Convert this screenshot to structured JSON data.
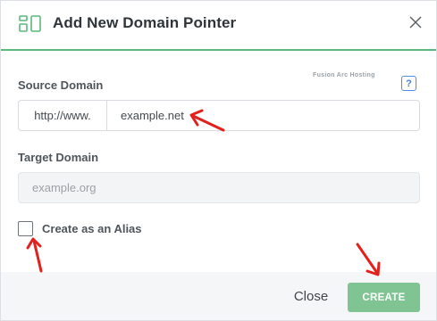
{
  "dialog": {
    "title": "Add New Domain Pointer",
    "header_icon": "domain-pointer-icon",
    "close_icon": "close-icon"
  },
  "source": {
    "label": "Source Domain",
    "prefix": "http://www.",
    "value": "example.net",
    "help_label": "?"
  },
  "watermark": "Fusion Arc Hosting",
  "target": {
    "label": "Target Domain",
    "placeholder": "example.org"
  },
  "alias": {
    "label": "Create as an Alias",
    "checked": false
  },
  "footer": {
    "close_label": "Close",
    "create_label": "CREATE"
  },
  "colors": {
    "accent": "#59b87c",
    "create_button": "#7fc492",
    "annotation_arrow": "#e3211c",
    "help": "#3b82e0"
  }
}
